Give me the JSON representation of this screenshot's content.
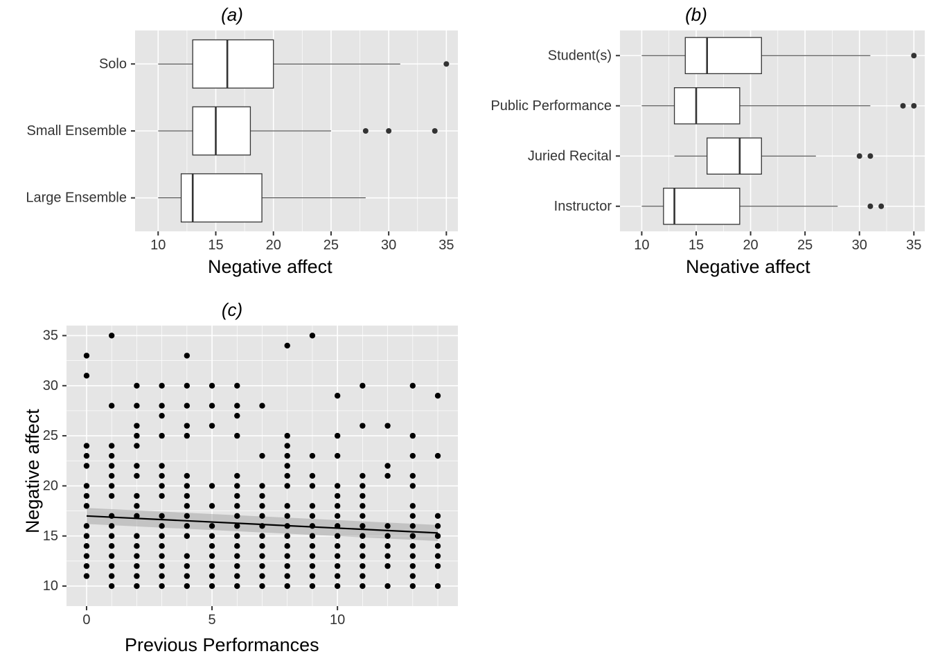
{
  "chart_data": [
    {
      "type": "boxplot",
      "panel_label": "(a)",
      "xlabel": "Negative affect",
      "xlim": [
        8,
        36
      ],
      "x_ticks": [
        10,
        15,
        20,
        25,
        30,
        35
      ],
      "categories": [
        "Solo",
        "Small Ensemble",
        "Large Ensemble"
      ],
      "boxes": [
        {
          "cat": "Solo",
          "min": 10,
          "q1": 13,
          "med": 16,
          "q3": 20,
          "max": 31,
          "outliers": [
            35
          ]
        },
        {
          "cat": "Small Ensemble",
          "min": 10,
          "q1": 13,
          "med": 15,
          "q3": 18,
          "max": 25,
          "outliers": [
            28,
            30,
            34
          ]
        },
        {
          "cat": "Large Ensemble",
          "min": 10,
          "q1": 12,
          "med": 13,
          "q3": 19,
          "max": 28,
          "outliers": []
        }
      ]
    },
    {
      "type": "boxplot",
      "panel_label": "(b)",
      "xlabel": "Negative affect",
      "xlim": [
        8,
        36
      ],
      "x_ticks": [
        10,
        15,
        20,
        25,
        30,
        35
      ],
      "categories": [
        "Student(s)",
        "Public Performance",
        "Juried Recital",
        "Instructor"
      ],
      "boxes": [
        {
          "cat": "Student(s)",
          "min": 10,
          "q1": 14,
          "med": 16,
          "q3": 21,
          "max": 31,
          "outliers": [
            35
          ]
        },
        {
          "cat": "Public Performance",
          "min": 10,
          "q1": 13,
          "med": 15,
          "q3": 19,
          "max": 31,
          "outliers": [
            34,
            35
          ]
        },
        {
          "cat": "Juried Recital",
          "min": 13,
          "q1": 16,
          "med": 19,
          "q3": 21,
          "max": 26,
          "outliers": [
            30,
            31
          ]
        },
        {
          "cat": "Instructor",
          "min": 10,
          "q1": 12,
          "med": 13,
          "q3": 19,
          "max": 28,
          "outliers": [
            31,
            32
          ]
        }
      ]
    },
    {
      "type": "scatter",
      "panel_label": "(c)",
      "xlabel": "Previous Performances",
      "ylabel": "Negative affect",
      "xlim": [
        -0.8,
        14.8
      ],
      "ylim": [
        8,
        36
      ],
      "x_ticks": [
        0,
        5,
        10
      ],
      "y_ticks": [
        10,
        15,
        20,
        25,
        30,
        35
      ],
      "trend": {
        "x0": 0,
        "y0": 17,
        "x1": 14,
        "y1": 15.3,
        "se": 0.8
      },
      "points": [
        [
          0,
          11
        ],
        [
          0,
          12
        ],
        [
          0,
          13
        ],
        [
          0,
          14
        ],
        [
          0,
          15
        ],
        [
          0,
          16
        ],
        [
          0,
          18
        ],
        [
          0,
          19
        ],
        [
          0,
          20
        ],
        [
          0,
          22
        ],
        [
          0,
          23
        ],
        [
          0,
          24
        ],
        [
          0,
          31
        ],
        [
          0,
          33
        ],
        [
          1,
          10
        ],
        [
          1,
          11
        ],
        [
          1,
          12
        ],
        [
          1,
          13
        ],
        [
          1,
          14
        ],
        [
          1,
          15
        ],
        [
          1,
          16
        ],
        [
          1,
          17
        ],
        [
          1,
          19
        ],
        [
          1,
          20
        ],
        [
          1,
          21
        ],
        [
          1,
          22
        ],
        [
          1,
          23
        ],
        [
          1,
          24
        ],
        [
          1,
          28
        ],
        [
          1,
          35
        ],
        [
          2,
          10
        ],
        [
          2,
          11
        ],
        [
          2,
          12
        ],
        [
          2,
          13
        ],
        [
          2,
          14
        ],
        [
          2,
          15
        ],
        [
          2,
          17
        ],
        [
          2,
          18
        ],
        [
          2,
          19
        ],
        [
          2,
          21
        ],
        [
          2,
          22
        ],
        [
          2,
          24
        ],
        [
          2,
          25
        ],
        [
          2,
          26
        ],
        [
          2,
          28
        ],
        [
          2,
          30
        ],
        [
          3,
          10
        ],
        [
          3,
          11
        ],
        [
          3,
          12
        ],
        [
          3,
          13
        ],
        [
          3,
          14
        ],
        [
          3,
          15
        ],
        [
          3,
          16
        ],
        [
          3,
          17
        ],
        [
          3,
          19
        ],
        [
          3,
          20
        ],
        [
          3,
          21
        ],
        [
          3,
          22
        ],
        [
          3,
          25
        ],
        [
          3,
          27
        ],
        [
          3,
          28
        ],
        [
          3,
          30
        ],
        [
          4,
          10
        ],
        [
          4,
          11
        ],
        [
          4,
          12
        ],
        [
          4,
          13
        ],
        [
          4,
          15
        ],
        [
          4,
          16
        ],
        [
          4,
          17
        ],
        [
          4,
          18
        ],
        [
          4,
          19
        ],
        [
          4,
          20
        ],
        [
          4,
          21
        ],
        [
          4,
          25
        ],
        [
          4,
          26
        ],
        [
          4,
          28
        ],
        [
          4,
          30
        ],
        [
          4,
          33
        ],
        [
          5,
          10
        ],
        [
          5,
          11
        ],
        [
          5,
          12
        ],
        [
          5,
          13
        ],
        [
          5,
          14
        ],
        [
          5,
          15
        ],
        [
          5,
          16
        ],
        [
          5,
          18
        ],
        [
          5,
          20
        ],
        [
          5,
          26
        ],
        [
          5,
          28
        ],
        [
          5,
          30
        ],
        [
          6,
          10
        ],
        [
          6,
          11
        ],
        [
          6,
          12
        ],
        [
          6,
          13
        ],
        [
          6,
          14
        ],
        [
          6,
          15
        ],
        [
          6,
          16
        ],
        [
          6,
          17
        ],
        [
          6,
          18
        ],
        [
          6,
          19
        ],
        [
          6,
          20
        ],
        [
          6,
          21
        ],
        [
          6,
          25
        ],
        [
          6,
          27
        ],
        [
          6,
          28
        ],
        [
          6,
          30
        ],
        [
          7,
          10
        ],
        [
          7,
          11
        ],
        [
          7,
          12
        ],
        [
          7,
          13
        ],
        [
          7,
          14
        ],
        [
          7,
          15
        ],
        [
          7,
          16
        ],
        [
          7,
          17
        ],
        [
          7,
          18
        ],
        [
          7,
          19
        ],
        [
          7,
          20
        ],
        [
          7,
          23
        ],
        [
          7,
          28
        ],
        [
          8,
          10
        ],
        [
          8,
          11
        ],
        [
          8,
          12
        ],
        [
          8,
          13
        ],
        [
          8,
          14
        ],
        [
          8,
          15
        ],
        [
          8,
          16
        ],
        [
          8,
          17
        ],
        [
          8,
          18
        ],
        [
          8,
          20
        ],
        [
          8,
          21
        ],
        [
          8,
          22
        ],
        [
          8,
          23
        ],
        [
          8,
          24
        ],
        [
          8,
          25
        ],
        [
          8,
          34
        ],
        [
          9,
          10
        ],
        [
          9,
          11
        ],
        [
          9,
          12
        ],
        [
          9,
          13
        ],
        [
          9,
          14
        ],
        [
          9,
          15
        ],
        [
          9,
          16
        ],
        [
          9,
          17
        ],
        [
          9,
          18
        ],
        [
          9,
          20
        ],
        [
          9,
          21
        ],
        [
          9,
          23
        ],
        [
          9,
          35
        ],
        [
          10,
          10
        ],
        [
          10,
          11
        ],
        [
          10,
          12
        ],
        [
          10,
          13
        ],
        [
          10,
          14
        ],
        [
          10,
          15
        ],
        [
          10,
          16
        ],
        [
          10,
          17
        ],
        [
          10,
          18
        ],
        [
          10,
          19
        ],
        [
          10,
          20
        ],
        [
          10,
          23
        ],
        [
          10,
          25
        ],
        [
          10,
          29
        ],
        [
          11,
          10
        ],
        [
          11,
          11
        ],
        [
          11,
          12
        ],
        [
          11,
          13
        ],
        [
          11,
          14
        ],
        [
          11,
          15
        ],
        [
          11,
          16
        ],
        [
          11,
          17
        ],
        [
          11,
          18
        ],
        [
          11,
          19
        ],
        [
          11,
          20
        ],
        [
          11,
          21
        ],
        [
          11,
          26
        ],
        [
          11,
          30
        ],
        [
          12,
          10
        ],
        [
          12,
          12
        ],
        [
          12,
          13
        ],
        [
          12,
          14
        ],
        [
          12,
          15
        ],
        [
          12,
          16
        ],
        [
          12,
          21
        ],
        [
          12,
          22
        ],
        [
          12,
          26
        ],
        [
          13,
          10
        ],
        [
          13,
          11
        ],
        [
          13,
          12
        ],
        [
          13,
          13
        ],
        [
          13,
          14
        ],
        [
          13,
          15
        ],
        [
          13,
          16
        ],
        [
          13,
          17
        ],
        [
          13,
          18
        ],
        [
          13,
          20
        ],
        [
          13,
          21
        ],
        [
          13,
          23
        ],
        [
          13,
          25
        ],
        [
          13,
          30
        ],
        [
          14,
          10
        ],
        [
          14,
          12
        ],
        [
          14,
          13
        ],
        [
          14,
          14
        ],
        [
          14,
          15
        ],
        [
          14,
          16
        ],
        [
          14,
          17
        ],
        [
          14,
          23
        ],
        [
          14,
          29
        ]
      ]
    }
  ]
}
